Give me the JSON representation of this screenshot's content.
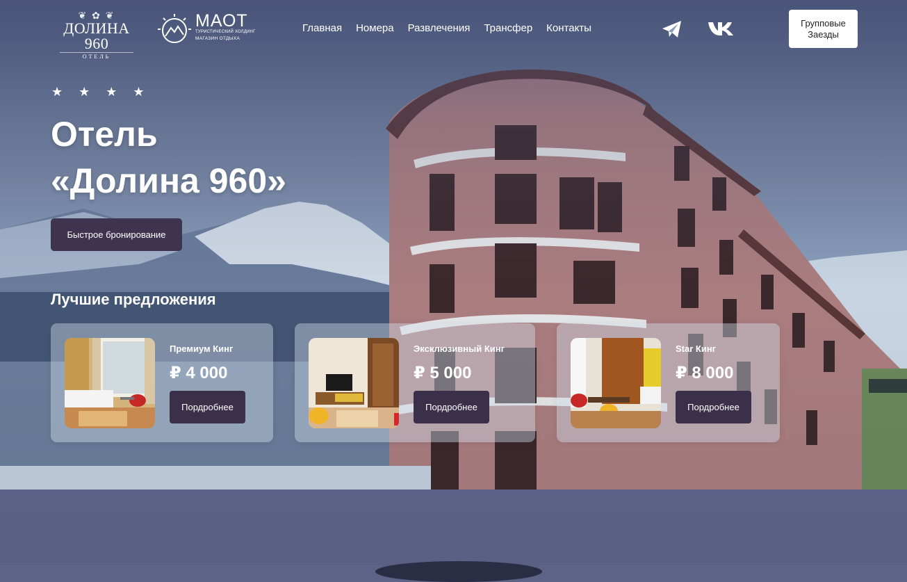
{
  "header": {
    "logo_dolina": {
      "name": "ДОЛИНА 960",
      "sub": "ОТЕЛЬ"
    },
    "logo_maot": {
      "title": "МАОТ",
      "line1": "ТУРИСТИЧЕСКИЙ ХОЛДИНГ",
      "line2": "МАГАЗИН ОТДЫХА"
    },
    "nav": [
      "Главная",
      "Номера",
      "Развлечения",
      "Трансфер",
      "Контакты"
    ],
    "social": [
      "telegram-icon",
      "vk-icon"
    ],
    "group_button": {
      "line1": "Групповые",
      "line2": "Заезды"
    }
  },
  "hero": {
    "stars": 4,
    "title_line1": "Отель",
    "title_line2": "«Долина 960»",
    "booking_button": "Быстрое бронирование"
  },
  "offers": {
    "title": "Лучшие предложения",
    "items": [
      {
        "name": "Премиум Кинг",
        "price": "₽ 4 000",
        "button": "Пордробнее"
      },
      {
        "name": "Эксклюзивный Кинг",
        "price": "₽ 5 000",
        "button": "Пордробнее"
      },
      {
        "name": "Star Кинг",
        "price": "₽ 8 000",
        "button": "Пордробнее"
      }
    ]
  },
  "colors": {
    "accent_button": "#3e3450",
    "header_button": "#ffffff",
    "building_wall": "#b88580"
  }
}
